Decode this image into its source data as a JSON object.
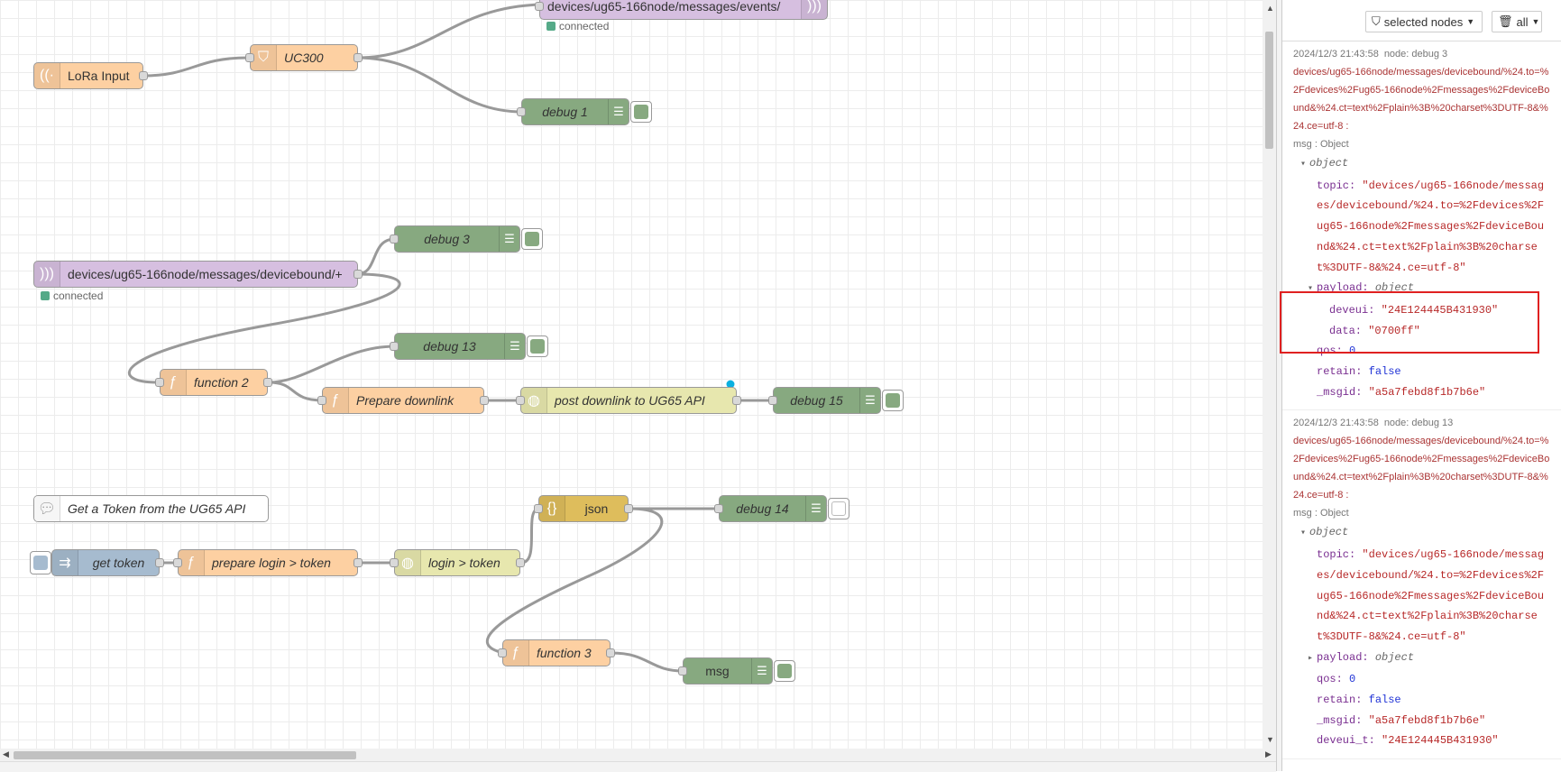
{
  "canvas": {
    "nodes": [
      {
        "id": "n-events",
        "label": "devices/ug65-166node/messages/events/",
        "color": "#d6bfe0",
        "icon": "mqtt-out-icon",
        "italic": false
      },
      {
        "id": "n-lora",
        "label": "LoRa Input",
        "color": "#fdd0a2",
        "icon": "lora-icon",
        "italic": false
      },
      {
        "id": "n-uc300",
        "label": "UC300",
        "color": "#fdd0a2",
        "icon": "filter-icon",
        "italic": true
      },
      {
        "id": "n-debug1",
        "label": "debug 1",
        "color": "#87a980",
        "icon": "debug-icon",
        "italic": true
      },
      {
        "id": "n-debug3",
        "label": "debug 3",
        "color": "#87a980",
        "icon": "debug-icon",
        "italic": true
      },
      {
        "id": "n-mqttin",
        "label": "devices/ug65-166node/messages/devicebound/+",
        "color": "#d6bfe0",
        "icon": "mqtt-in-icon",
        "italic": false
      },
      {
        "id": "n-debug13",
        "label": "debug 13",
        "color": "#87a980",
        "icon": "debug-icon",
        "italic": true
      },
      {
        "id": "n-func2",
        "label": "function 2",
        "color": "#fdd0a2",
        "icon": "function-icon",
        "italic": true
      },
      {
        "id": "n-prep",
        "label": "Prepare downlink",
        "color": "#fdd0a2",
        "icon": "function-icon",
        "italic": true
      },
      {
        "id": "n-post",
        "label": "post downlink to UG65 API",
        "color": "#e7e7ae",
        "icon": "http-icon",
        "italic": true
      },
      {
        "id": "n-debug15",
        "label": "debug 15",
        "color": "#87a980",
        "icon": "debug-icon",
        "italic": true
      },
      {
        "id": "n-comment",
        "label": "Get a Token from the UG65 API",
        "color": "#ffffff",
        "icon": "comment-icon",
        "italic": true
      },
      {
        "id": "n-json",
        "label": "json",
        "color": "#debd5c",
        "icon": "json-icon",
        "italic": false
      },
      {
        "id": "n-debug14",
        "label": "debug 14",
        "color": "#87a980",
        "icon": "debug-icon",
        "italic": true
      },
      {
        "id": "n-gettoken",
        "label": "get token",
        "color": "#a6bbcf",
        "icon": "inject-icon",
        "italic": true
      },
      {
        "id": "n-preplogin",
        "label": "prepare login > token",
        "color": "#fdd0a2",
        "icon": "function-icon",
        "italic": true
      },
      {
        "id": "n-login",
        "label": "login > token",
        "color": "#e7e7ae",
        "icon": "http-icon",
        "italic": true
      },
      {
        "id": "n-func3",
        "label": "function 3",
        "color": "#fdd0a2",
        "icon": "function-icon",
        "italic": true
      },
      {
        "id": "n-msg",
        "label": "msg",
        "color": "#87a980",
        "icon": "debug-icon",
        "italic": false
      }
    ],
    "status_events": "connected",
    "status_mqttin": "connected"
  },
  "sidebar": {
    "filter_label": "selected nodes",
    "clear_label": "all",
    "messages": [
      {
        "timestamp": "2024/12/3 21:43:58",
        "node": "node: debug 3",
        "topic_path": "devices/ug65-166node/messages/devicebound/%24.to=%2Fdevices%2Fug65-166node%2Fmessages%2FdeviceBound&%24.ct=text%2Fplain%3B%20charset%3DUTF-8&%24.ce=utf-8 :",
        "msg_type": "msg : Object",
        "root": "object",
        "topic_key": "topic:",
        "topic_value": "\"devices/ug65-166node/messages/devicebound/%24.to=%2Fdevices%2Fug65-166node%2Fmessages%2FdeviceBound&%24.ct=text%2Fplain%3B%20charset%3DUTF-8&%24.ce=utf-8\"",
        "payload_key": "payload:",
        "payload_type": "object",
        "deveui_key": "deveui:",
        "deveui_value": "\"24E124445B431930\"",
        "data_key": "data:",
        "data_value": "\"0700ff\"",
        "qos_key": "qos:",
        "qos_value": "0",
        "retain_key": "retain:",
        "retain_value": "false",
        "msgid_key": "_msgid:",
        "msgid_value": "\"a5a7febd8f1b7b6e\""
      },
      {
        "timestamp": "2024/12/3 21:43:58",
        "node": "node: debug 13",
        "topic_path": "devices/ug65-166node/messages/devicebound/%24.to=%2Fdevices%2Fug65-166node%2Fmessages%2FdeviceBound&%24.ct=text%2Fplain%3B%20charset%3DUTF-8&%24.ce=utf-8 :",
        "msg_type": "msg : Object",
        "root": "object",
        "topic_key": "topic:",
        "topic_value": "\"devices/ug65-166node/messages/devicebound/%24.to=%2Fdevices%2Fug65-166node%2Fmessages%2FdeviceBound&%24.ct=text%2Fplain%3B%20charset%3DUTF-8&%24.ce=utf-8\"",
        "payload_key": "payload:",
        "payload_type": "object",
        "qos_key": "qos:",
        "qos_value": "0",
        "retain_key": "retain:",
        "retain_value": "false",
        "msgid_key": "_msgid:",
        "msgid_value": "\"a5a7febd8f1b7b6e\"",
        "deveui_t_key": "deveui_t:",
        "deveui_t_value": "\"24E124445B431930\""
      }
    ]
  }
}
